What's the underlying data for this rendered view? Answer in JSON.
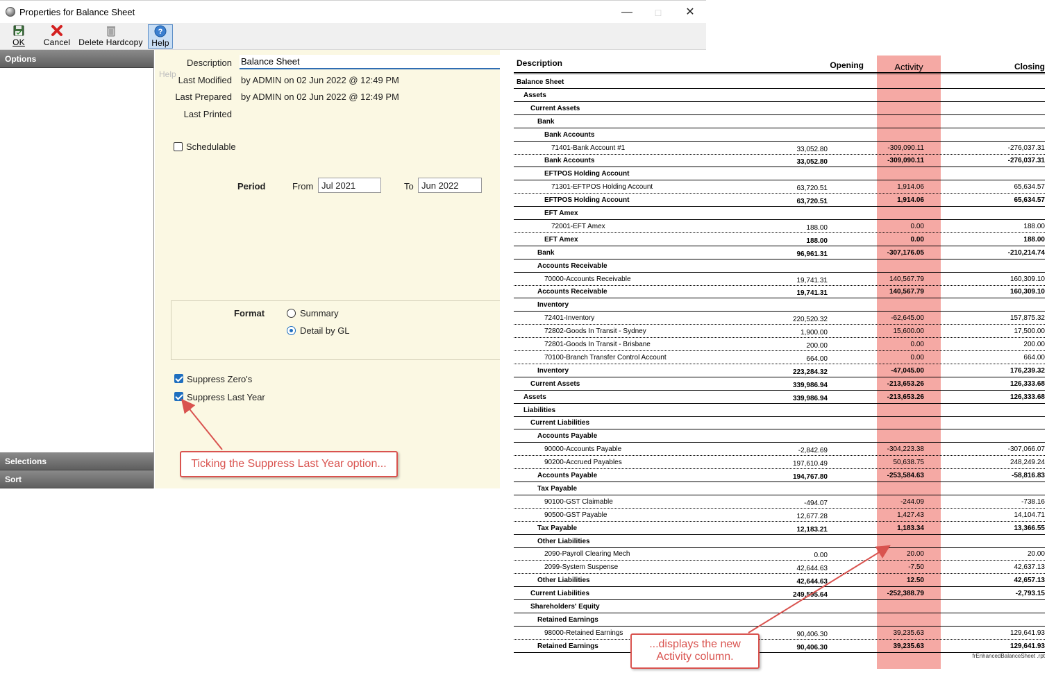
{
  "window": {
    "title": "Properties for Balance Sheet",
    "controls": {
      "minimize": "—",
      "maximize": "□",
      "close": "✕"
    }
  },
  "toolbar": {
    "ok": {
      "label": "OK",
      "icon": "save-disk-icon"
    },
    "cancel": {
      "label": "Cancel",
      "icon": "red-x-icon"
    },
    "delete_hardcopy": {
      "label": "Delete Hardcopy",
      "icon": "trash-icon"
    },
    "help": {
      "label": "Help",
      "icon": "question-icon"
    }
  },
  "sidebar": {
    "options": "Options",
    "selections": "Selections",
    "sort": "Sort"
  },
  "form": {
    "description_label": "Description",
    "description_value": "Balance Sheet",
    "help_hint": "Help",
    "last_modified_label": "Last Modified",
    "last_modified_value": "by ADMIN on 02 Jun 2022 @ 12:49 PM",
    "last_prepared_label": "Last Prepared",
    "last_prepared_value": "by ADMIN on 02 Jun 2022 @ 12:49 PM",
    "last_printed_label": "Last Printed",
    "schedulable_label": "Schedulable",
    "schedulable_checked": false,
    "period_label": "Period",
    "from_label": "From",
    "from_value": "Jul 2021",
    "to_label": "To",
    "to_value": "Jun 2022",
    "format_label": "Format",
    "format_summary": "Summary",
    "format_detail": "Detail by GL",
    "format_selected": "Detail by GL",
    "suppress_zeros_label": "Suppress Zero's",
    "suppress_zeros_checked": true,
    "suppress_last_year_label": "Suppress Last Year",
    "suppress_last_year_checked": true
  },
  "callouts": {
    "left": "Ticking the Suppress Last Year option...",
    "right_line1": "...displays  the new",
    "right_line2": "Activity column."
  },
  "colors": {
    "activity_highlight": "#f5a9a4",
    "callout_red": "#d9534f",
    "panel_bg": "#fbf8e3",
    "accent_blue": "#1f6fbf"
  },
  "report": {
    "headers": {
      "description": "Description",
      "opening": "Opening",
      "activity": "Activity",
      "closing": "Closing"
    },
    "footer": "frEnhancedBalanceSheet  .rpt",
    "rows": [
      {
        "desc": "Balance Sheet",
        "level": 0,
        "type": "header",
        "opening": "",
        "activity": "",
        "closing": ""
      },
      {
        "desc": "Assets",
        "level": 1,
        "type": "header",
        "opening": "",
        "activity": "",
        "closing": ""
      },
      {
        "desc": "Current Assets",
        "level": 2,
        "type": "header",
        "opening": "",
        "activity": "",
        "closing": ""
      },
      {
        "desc": "Bank",
        "level": 3,
        "type": "header",
        "opening": "",
        "activity": "",
        "closing": ""
      },
      {
        "desc": "Bank Accounts",
        "level": 4,
        "type": "header",
        "opening": "",
        "activity": "",
        "closing": ""
      },
      {
        "desc": "71401-Bank Account #1",
        "level": 5,
        "type": "detail",
        "opening": "33,052.80",
        "activity": "-309,090.11",
        "closing": "-276,037.31"
      },
      {
        "desc": "Bank Accounts",
        "level": 4,
        "type": "total",
        "opening": "33,052.80",
        "activity": "-309,090.11",
        "closing": "-276,037.31"
      },
      {
        "desc": "EFTPOS Holding Account",
        "level": 4,
        "type": "header",
        "opening": "",
        "activity": "",
        "closing": ""
      },
      {
        "desc": "71301-EFTPOS Holding Account",
        "level": 5,
        "type": "detail",
        "opening": "63,720.51",
        "activity": "1,914.06",
        "closing": "65,634.57"
      },
      {
        "desc": "EFTPOS Holding Account",
        "level": 4,
        "type": "total",
        "opening": "63,720.51",
        "activity": "1,914.06",
        "closing": "65,634.57"
      },
      {
        "desc": "EFT Amex",
        "level": 4,
        "type": "header",
        "opening": "",
        "activity": "",
        "closing": ""
      },
      {
        "desc": "72001-EFT Amex",
        "level": 5,
        "type": "detail",
        "opening": "188.00",
        "activity": "0.00",
        "closing": "188.00"
      },
      {
        "desc": "EFT Amex",
        "level": 4,
        "type": "total",
        "opening": "188.00",
        "activity": "0.00",
        "closing": "188.00"
      },
      {
        "desc": "Bank",
        "level": 3,
        "type": "total",
        "opening": "96,961.31",
        "activity": "-307,176.05",
        "closing": "-210,214.74"
      },
      {
        "desc": "Accounts Receivable",
        "level": 3,
        "type": "header",
        "opening": "",
        "activity": "",
        "closing": ""
      },
      {
        "desc": "70000-Accounts Receivable",
        "level": 4,
        "type": "detail",
        "opening": "19,741.31",
        "activity": "140,567.79",
        "closing": "160,309.10"
      },
      {
        "desc": "Accounts Receivable",
        "level": 3,
        "type": "total",
        "opening": "19,741.31",
        "activity": "140,567.79",
        "closing": "160,309.10"
      },
      {
        "desc": "Inventory",
        "level": 3,
        "type": "header",
        "opening": "",
        "activity": "",
        "closing": ""
      },
      {
        "desc": "72401-Inventory",
        "level": 4,
        "type": "detail",
        "opening": "220,520.32",
        "activity": "-62,645.00",
        "closing": "157,875.32"
      },
      {
        "desc": "72802-Goods In Transit - Sydney",
        "level": 4,
        "type": "detail",
        "opening": "1,900.00",
        "activity": "15,600.00",
        "closing": "17,500.00"
      },
      {
        "desc": "72801-Goods In Transit - Brisbane",
        "level": 4,
        "type": "detail",
        "opening": "200.00",
        "activity": "0.00",
        "closing": "200.00"
      },
      {
        "desc": "70100-Branch Transfer Control Account",
        "level": 4,
        "type": "detail",
        "opening": "664.00",
        "activity": "0.00",
        "closing": "664.00"
      },
      {
        "desc": "Inventory",
        "level": 3,
        "type": "total",
        "opening": "223,284.32",
        "activity": "-47,045.00",
        "closing": "176,239.32"
      },
      {
        "desc": "Current Assets",
        "level": 2,
        "type": "total",
        "opening": "339,986.94",
        "activity": "-213,653.26",
        "closing": "126,333.68"
      },
      {
        "desc": "Assets",
        "level": 1,
        "type": "total",
        "opening": "339,986.94",
        "activity": "-213,653.26",
        "closing": "126,333.68"
      },
      {
        "desc": "Liabilities",
        "level": 1,
        "type": "header",
        "opening": "",
        "activity": "",
        "closing": ""
      },
      {
        "desc": "Current Liabilities",
        "level": 2,
        "type": "header",
        "opening": "",
        "activity": "",
        "closing": ""
      },
      {
        "desc": "Accounts Payable",
        "level": 3,
        "type": "header",
        "opening": "",
        "activity": "",
        "closing": ""
      },
      {
        "desc": "90000-Accounts Payable",
        "level": 4,
        "type": "detail",
        "opening": "-2,842.69",
        "activity": "-304,223.38",
        "closing": "-307,066.07"
      },
      {
        "desc": "90200-Accrued Payables",
        "level": 4,
        "type": "detail",
        "opening": "197,610.49",
        "activity": "50,638.75",
        "closing": "248,249.24"
      },
      {
        "desc": "Accounts Payable",
        "level": 3,
        "type": "total",
        "opening": "194,767.80",
        "activity": "-253,584.63",
        "closing": "-58,816.83"
      },
      {
        "desc": "Tax Payable",
        "level": 3,
        "type": "header",
        "opening": "",
        "activity": "",
        "closing": ""
      },
      {
        "desc": "90100-GST Claimable",
        "level": 4,
        "type": "detail",
        "opening": "-494.07",
        "activity": "-244.09",
        "closing": "-738.16"
      },
      {
        "desc": "90500-GST Payable",
        "level": 4,
        "type": "detail",
        "opening": "12,677.28",
        "activity": "1,427.43",
        "closing": "14,104.71"
      },
      {
        "desc": "Tax Payable",
        "level": 3,
        "type": "total",
        "opening": "12,183.21",
        "activity": "1,183.34",
        "closing": "13,366.55"
      },
      {
        "desc": "Other Liabilities",
        "level": 3,
        "type": "header",
        "opening": "",
        "activity": "",
        "closing": ""
      },
      {
        "desc": "2090-Payroll Clearing Mech",
        "level": 4,
        "type": "detail",
        "opening": "0.00",
        "activity": "20.00",
        "closing": "20.00"
      },
      {
        "desc": "2099-System Suspense",
        "level": 4,
        "type": "detail",
        "opening": "42,644.63",
        "activity": "-7.50",
        "closing": "42,637.13"
      },
      {
        "desc": "Other Liabilities",
        "level": 3,
        "type": "total",
        "opening": "42,644.63",
        "activity": "12.50",
        "closing": "42,657.13"
      },
      {
        "desc": "Current Liabilities",
        "level": 2,
        "type": "total",
        "opening": "249,595.64",
        "activity": "-252,388.79",
        "closing": "-2,793.15"
      },
      {
        "desc": "Shareholders' Equity",
        "level": 2,
        "type": "header",
        "opening": "",
        "activity": "",
        "closing": ""
      },
      {
        "desc": "Retained Earnings",
        "level": 3,
        "type": "header",
        "opening": "",
        "activity": "",
        "closing": ""
      },
      {
        "desc": "98000-Retained Earnings",
        "level": 4,
        "type": "detail",
        "opening": "90,406.30",
        "activity": "39,235.63",
        "closing": "129,641.93"
      },
      {
        "desc": "Retained Earnings",
        "level": 3,
        "type": "total",
        "opening": "90,406.30",
        "activity": "39,235.63",
        "closing": "129,641.93"
      }
    ]
  }
}
